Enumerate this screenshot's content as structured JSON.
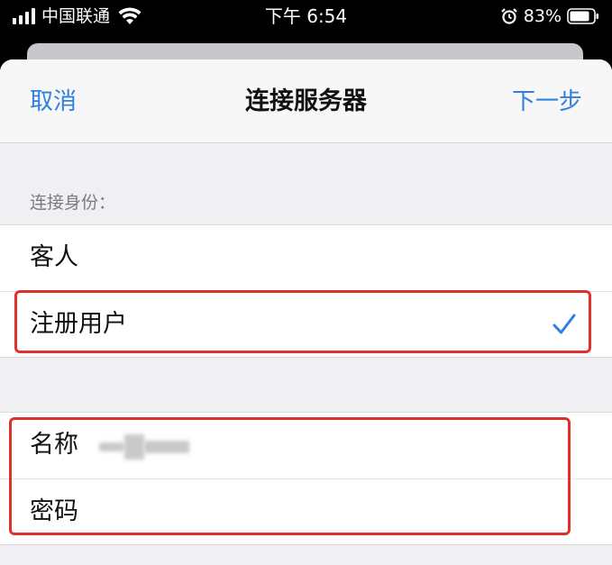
{
  "status_bar": {
    "carrier": "中国联通",
    "time": "下午 6:54",
    "battery_percent": "83%",
    "icons": [
      "signal-bars-icon",
      "wifi-icon",
      "alarm-icon",
      "battery-icon"
    ]
  },
  "nav": {
    "cancel": "取消",
    "title": "连接服务器",
    "next": "下一步"
  },
  "connect_as": {
    "header": "连接身份：",
    "options": [
      {
        "label": "客人",
        "selected": false
      },
      {
        "label": "注册用户",
        "selected": true
      }
    ]
  },
  "credentials": {
    "name_label": "名称",
    "password_label": "密码"
  },
  "colors": {
    "accent": "#2f7fe0",
    "highlight": "#e0302c"
  }
}
